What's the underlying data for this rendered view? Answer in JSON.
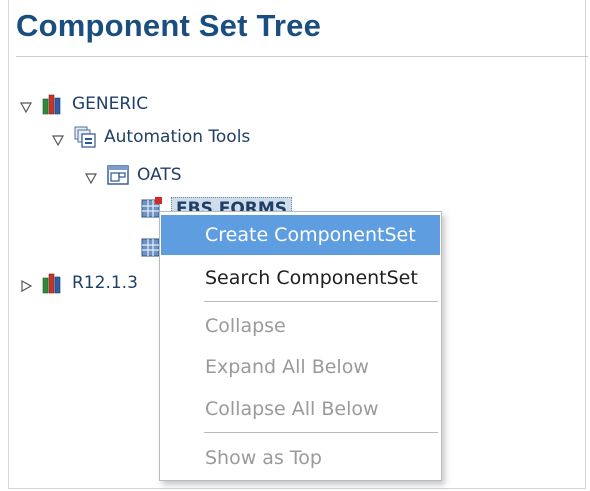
{
  "panel": {
    "title": "Component Set Tree"
  },
  "tree": {
    "root": {
      "label": "GENERIC"
    },
    "child": {
      "label": "Automation Tools"
    },
    "grandchild": {
      "label": "OATS"
    },
    "leaf_selected": {
      "label": "EBS FORMS"
    },
    "other_root": {
      "label": "R12.1.3"
    }
  },
  "context_menu": {
    "items": [
      {
        "label": "Create ComponentSet",
        "state": "highlighted"
      },
      {
        "label": "Search ComponentSet",
        "state": "enabled"
      },
      {
        "label": "Collapse",
        "state": "disabled"
      },
      {
        "label": "Expand All Below",
        "state": "disabled"
      },
      {
        "label": "Collapse All Below",
        "state": "disabled"
      },
      {
        "label": "Show as Top",
        "state": "disabled"
      }
    ]
  },
  "colors": {
    "title": "#1b4e80",
    "menu_highlight": "#5d9de0",
    "disabled_text": "#9a9a9a"
  }
}
